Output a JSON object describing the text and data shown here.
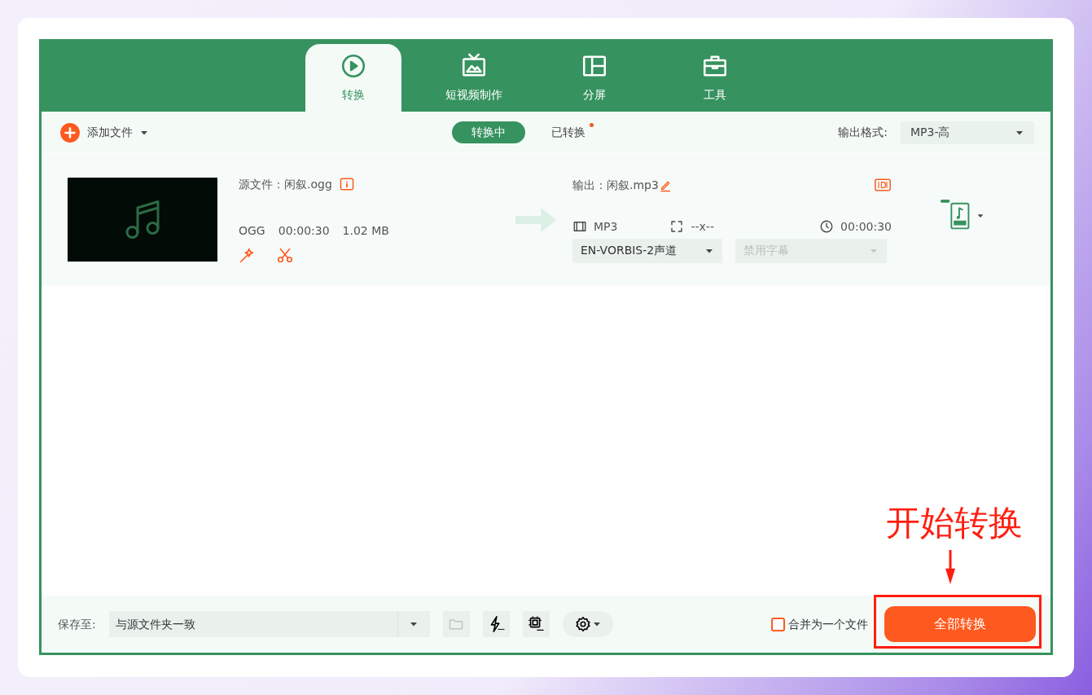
{
  "tabs": [
    {
      "label": "转换",
      "kind": "convert",
      "selected": true
    },
    {
      "label": "短视频制作",
      "kind": "tv",
      "selected": false
    },
    {
      "label": "分屏",
      "kind": "split",
      "selected": false
    },
    {
      "label": "工具",
      "kind": "toolbox",
      "selected": false
    }
  ],
  "toolbar": {
    "add_button": "添加文件",
    "status_tabs": [
      {
        "label": "转换中",
        "selected": true,
        "new_dot": false
      },
      {
        "label": "已转换",
        "selected": false,
        "new_dot": true
      }
    ],
    "format_label": "输出格式:",
    "format_value": "MP3-高"
  },
  "files": [
    {
      "source": "源文件：闲叙.ogg",
      "format": "OGG",
      "duration": "00:00:30",
      "size": "1.02 MB",
      "output": "输出：闲叙.mp3",
      "out_format": "MP3",
      "resolution": "--x--",
      "out_duration": "00:00:30",
      "audio_track": "EN-VORBIS-2声道",
      "subtitle": "禁用字幕",
      "subtitle_disabled": true
    }
  ],
  "bottom": {
    "save_label": "保存至:",
    "save_path": "与源文件夹一致",
    "merge_label": "合并为一个文件",
    "merge_checked": false,
    "convert_all": "全部转换"
  },
  "annotation": "开始转换"
}
